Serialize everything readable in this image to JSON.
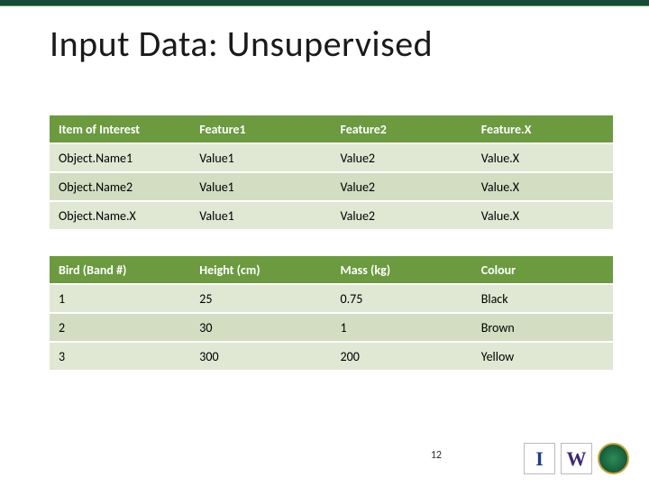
{
  "title": "Input Data: Unsupervised",
  "page_number": "12",
  "chart_data": [
    {
      "type": "table",
      "columns": [
        "Item of Interest",
        "Feature1",
        "Feature2",
        "Feature.X"
      ],
      "rows": [
        [
          "Object.Name1",
          "Value1",
          "Value2",
          "Value.X"
        ],
        [
          "Object.Name2",
          "Value1",
          "Value2",
          "Value.X"
        ],
        [
          "Object.Name.X",
          "Value1",
          "Value2",
          "Value.X"
        ]
      ]
    },
    {
      "type": "table",
      "columns": [
        "Bird (Band #)",
        "Height (cm)",
        "Mass (kg)",
        "Colour"
      ],
      "rows": [
        [
          "1",
          "25",
          "0.75",
          "Black"
        ],
        [
          "2",
          "30",
          "1",
          "Brown"
        ],
        [
          "3",
          "300",
          "200",
          "Yellow"
        ]
      ]
    }
  ],
  "logos": [
    "I",
    "W",
    "seal"
  ]
}
